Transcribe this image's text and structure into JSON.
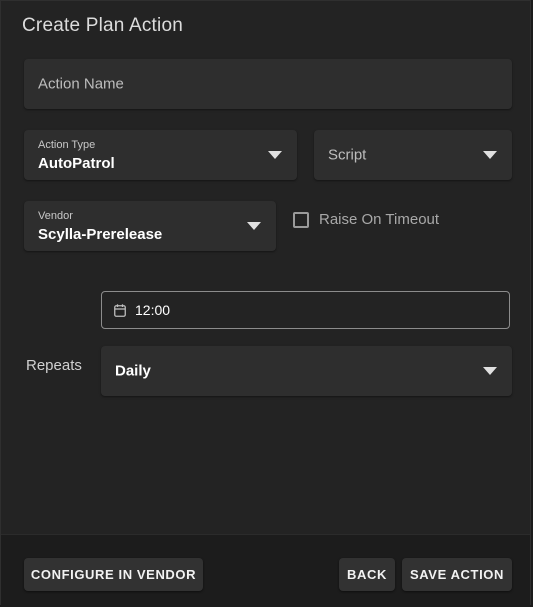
{
  "dialog": {
    "title": "Create Plan Action"
  },
  "form": {
    "action_name": {
      "placeholder": "Action Name"
    },
    "action_type": {
      "label": "Action Type",
      "value": "AutoPatrol"
    },
    "script": {
      "placeholder": "Script"
    },
    "vendor": {
      "label": "Vendor",
      "value": "Scylla-Prerelease"
    },
    "raise_on_timeout": {
      "label": "Raise On Timeout",
      "checked": false
    },
    "time": {
      "value": "12:00",
      "icon": "calendar-icon"
    },
    "repeats": {
      "label": "Repeats",
      "value": "Daily"
    }
  },
  "footer": {
    "configure_label": "CONFIGURE IN VENDOR",
    "back_label": "BACK",
    "save_label": "SAVE ACTION"
  },
  "colors": {
    "background": "#232323",
    "field": "#2e2e2e",
    "footer": "#1c1c1c",
    "button": "#323232"
  }
}
